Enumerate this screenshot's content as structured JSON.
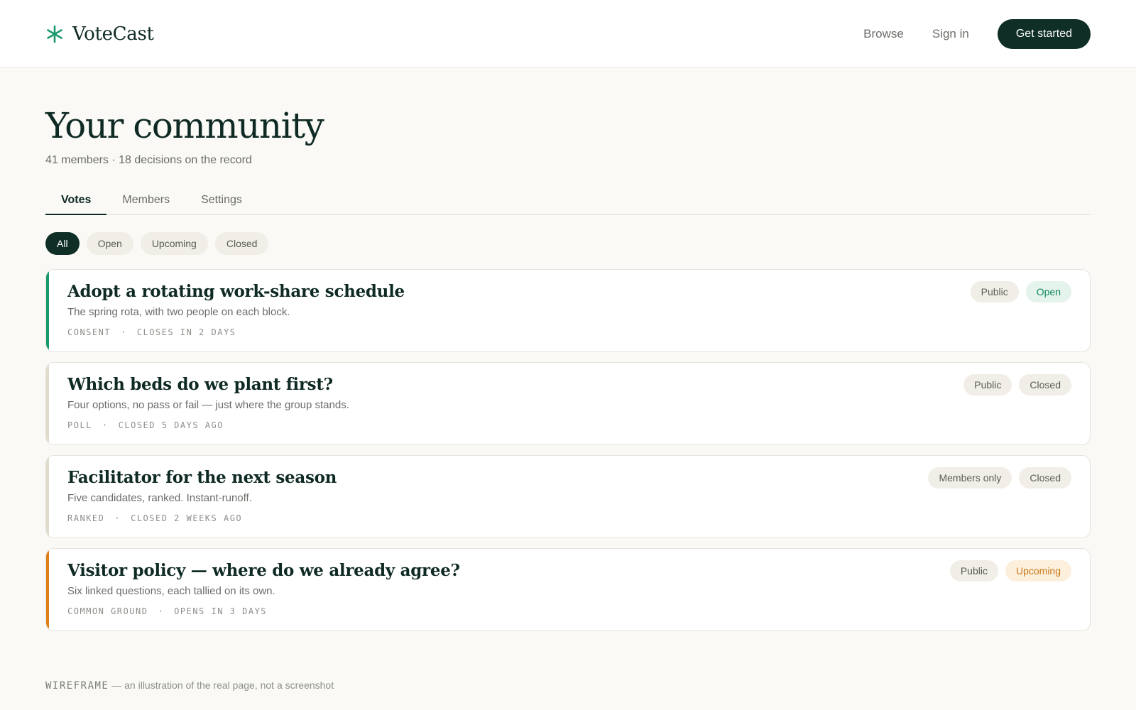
{
  "header": {
    "brand_name": "VoteCast",
    "brand_icon": "asterisk-icon",
    "nav": {
      "browse": "Browse",
      "sign_in": "Sign in"
    },
    "cta": "Get started"
  },
  "page": {
    "title": "Your community",
    "subtitle": "41 members · 18 decisions on the record"
  },
  "tabs": [
    {
      "label": "Votes",
      "active": true
    },
    {
      "label": "Members",
      "active": false
    },
    {
      "label": "Settings",
      "active": false
    }
  ],
  "filters": [
    {
      "label": "All",
      "active": true
    },
    {
      "label": "Open",
      "active": false
    },
    {
      "label": "Upcoming",
      "active": false
    },
    {
      "label": "Closed",
      "active": false
    }
  ],
  "votes": [
    {
      "title": "Adopt a rotating work-share schedule",
      "description": "The spring rota, with two people on each block.",
      "type": "Consent",
      "timing": "Closes in 2 days",
      "visibility": "Public",
      "status": "Open",
      "accent_color": "#1a9a6c"
    },
    {
      "title": "Which beds do we plant first?",
      "description": "Four options, no pass or fail — just where the group stands.",
      "type": "Poll",
      "timing": "Closed 5 days ago",
      "visibility": "Public",
      "status": "Closed",
      "accent_color": "#e0dbcd"
    },
    {
      "title": "Facilitator for the next season",
      "description": "Five candidates, ranked. Instant-runoff.",
      "type": "Ranked",
      "timing": "Closed 2 weeks ago",
      "visibility": "Members only",
      "status": "Closed",
      "accent_color": "#e0dbcd"
    },
    {
      "title": "Visitor policy — where do we already agree?",
      "description": "Six linked questions, each tallied on its own.",
      "type": "Common ground",
      "timing": "Opens in 3 days",
      "visibility": "Public",
      "status": "Upcoming",
      "accent_color": "#dd7f16"
    }
  ],
  "meta_separator": "·",
  "footnote": {
    "label": "WIREFRAME",
    "text": " — an illustration of the real page, not a screenshot"
  }
}
